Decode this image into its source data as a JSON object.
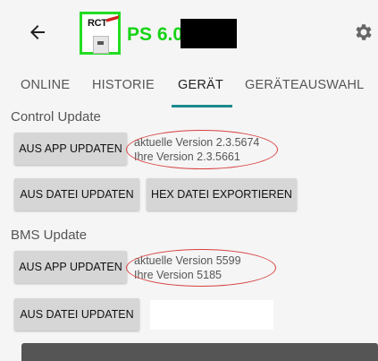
{
  "header": {
    "logo_text": "RCT",
    "model": "PS 6.0"
  },
  "tabs": [
    {
      "label": "ONLINE",
      "active": false
    },
    {
      "label": "HISTORIE",
      "active": false
    },
    {
      "label": "GERÄT",
      "active": true
    },
    {
      "label": "GERÄTEAUSWAHL",
      "active": false
    }
  ],
  "control_update": {
    "title": "Control Update",
    "app_update_button": "AUS APP UPDATEN",
    "current_version": "aktuelle Version 2.3.5674",
    "your_version": "Ihre Version 2.3.5661",
    "file_update_button": "AUS DATEI UPDATEN",
    "hex_export_button": "HEX DATEI EXPORTIEREN"
  },
  "bms_update": {
    "title": "BMS Update",
    "app_update_button": "AUS APP UPDATEN",
    "current_version": "aktuelle Version 5599",
    "your_version": "Ihre Version 5185",
    "file_update_button": "AUS DATEI UPDATEN"
  },
  "colors": {
    "accent": "#1a8a8f",
    "model_text": "#16d316",
    "annotation": "#d84040"
  }
}
